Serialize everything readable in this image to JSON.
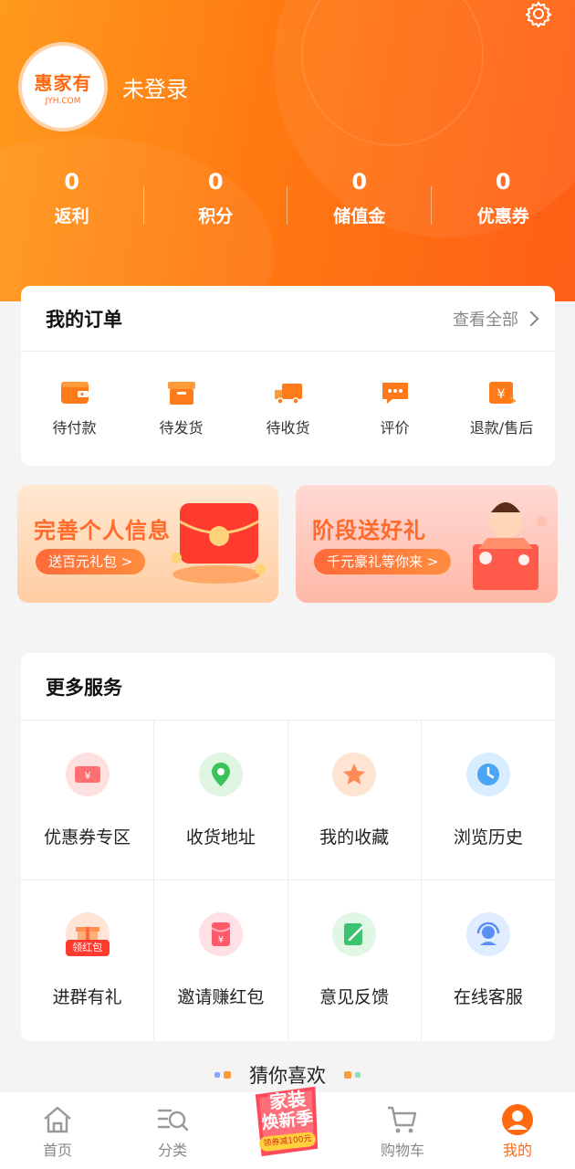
{
  "header": {
    "brand": "惠家有",
    "brand_sub": "JYH.COM",
    "login_status": "未登录",
    "stats": [
      {
        "value": "0",
        "label": "返利"
      },
      {
        "value": "0",
        "label": "积分"
      },
      {
        "value": "0",
        "label": "储值金"
      },
      {
        "value": "0",
        "label": "优惠券"
      }
    ]
  },
  "orders": {
    "title": "我的订单",
    "view_all": "查看全部",
    "items": [
      {
        "label": "待付款",
        "icon": "wallet-icon"
      },
      {
        "label": "待发货",
        "icon": "box-icon"
      },
      {
        "label": "待收货",
        "icon": "truck-icon"
      },
      {
        "label": "评价",
        "icon": "chat-icon"
      },
      {
        "label": "退款/售后",
        "icon": "refund-icon"
      }
    ]
  },
  "banners": [
    {
      "title": "完善个人信息",
      "pill": "送百元礼包 >"
    },
    {
      "title": "阶段送好礼",
      "pill": "千元豪礼等你来 >"
    }
  ],
  "services": {
    "title": "更多服务",
    "items": [
      {
        "label": "优惠券专区",
        "icon": "coupon-icon"
      },
      {
        "label": "收货地址",
        "icon": "location-icon"
      },
      {
        "label": "我的收藏",
        "icon": "star-icon"
      },
      {
        "label": "浏览历史",
        "icon": "clock-icon"
      },
      {
        "label": "进群有礼",
        "icon": "gift-icon",
        "badge": "领红包"
      },
      {
        "label": "邀请赚红包",
        "icon": "red-envelope-icon"
      },
      {
        "label": "意见反馈",
        "icon": "feedback-icon"
      },
      {
        "label": "在线客服",
        "icon": "headset-icon"
      }
    ]
  },
  "guess": {
    "title": "猜你喜欢"
  },
  "promo": {
    "line1": "家装",
    "line2": "焕新季",
    "line3": "领券减100元"
  },
  "bottom_nav": [
    {
      "label": "首页",
      "icon": "home-icon"
    },
    {
      "label": "分类",
      "icon": "category-search-icon"
    },
    {
      "label": "",
      "icon": "promo-icon"
    },
    {
      "label": "购物车",
      "icon": "cart-icon"
    },
    {
      "label": "我的",
      "icon": "profile-icon"
    }
  ],
  "colors": {
    "accent": "#ff6a10",
    "header_start": "#ff9a1e",
    "header_end": "#ff5e16"
  }
}
